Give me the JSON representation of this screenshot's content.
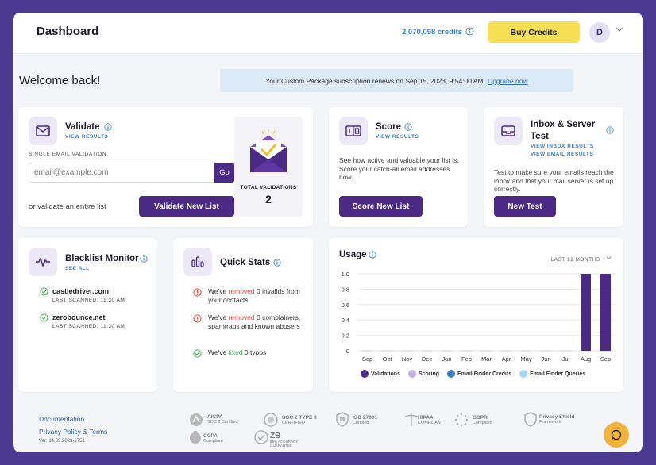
{
  "header": {
    "title": "Dashboard",
    "credits": "2,070,098 credits",
    "buy_label": "Buy Credits",
    "avatar_initial": "D"
  },
  "welcome": "Welcome back!",
  "banner": {
    "text": "Your Custom Package subscription renews on Sep 15, 2023, 9:54:00 AM.",
    "link": "Upgrade now"
  },
  "validate": {
    "title": "Validate",
    "link": "VIEW RESULTS",
    "subtitle": "SINGLE EMAIL VALIDATION",
    "placeholder": "email@example.com",
    "go_label": "Go",
    "or_text": "or validate an entire list",
    "button": "Validate New List",
    "total_label": "TOTAL VALIDATIONS",
    "total_value": "2"
  },
  "score": {
    "title": "Score",
    "link": "VIEW RESULTS",
    "desc": "See how active and valuable your list is. Score your catch-all email addresses now.",
    "button": "Score New List"
  },
  "inbox": {
    "title": "Inbox & Server Test",
    "link1": "VIEW INBOX RESULTS",
    "link2": "VIEW EMAIL RESULTS",
    "desc": "Test to make sure your emails reach the inbox and that your mail server is set up correctly.",
    "button": "New Test"
  },
  "blacklist": {
    "title": "Blacklist Monitor",
    "link": "SEE ALL",
    "items": [
      {
        "domain": "castledriver.com",
        "scan": "LAST SCANNED: 11:30 AM"
      },
      {
        "domain": "zerobounce.net",
        "scan": "LAST SCANNED: 11:30 AM"
      }
    ]
  },
  "quickstats": {
    "title": "Quick Stats",
    "item1_a": "We've ",
    "item1_b": "removed",
    "item1_c": " 0 invalids from your contacts",
    "item2_a": "We've ",
    "item2_b": "removed",
    "item2_c": " 0 complainers, spamtraps and known abusers",
    "item3_a": "We've ",
    "item3_b": "fixed",
    "item3_c": " 0 typos"
  },
  "usage": {
    "title": "Usage",
    "range": "LAST 12 MONTHS"
  },
  "chart_data": {
    "type": "bar",
    "categories": [
      "Sep",
      "Oct",
      "Nov",
      "Dec",
      "Jan",
      "Feb",
      "Mar",
      "Apr",
      "May",
      "Jun",
      "Jul",
      "Aug",
      "Sep"
    ],
    "series": [
      {
        "name": "Validations",
        "color": "#4a2a85",
        "values": [
          0,
          0,
          0,
          0,
          0,
          0,
          0,
          0,
          0,
          0,
          0,
          1,
          1
        ]
      },
      {
        "name": "Scoring",
        "color": "#c5b3e6",
        "values": [
          0,
          0,
          0,
          0,
          0,
          0,
          0,
          0,
          0,
          0,
          0,
          0,
          0
        ]
      },
      {
        "name": "Email Finder Credits",
        "color": "#3e7dc4",
        "values": [
          0,
          0,
          0,
          0,
          0,
          0,
          0,
          0,
          0,
          0,
          0,
          0,
          0
        ]
      },
      {
        "name": "Email Finder Queries",
        "color": "#a9d6f2",
        "values": [
          0,
          0,
          0,
          0,
          0,
          0,
          0,
          0,
          0,
          0,
          0,
          0,
          0
        ]
      }
    ],
    "yticks": [
      "1.0",
      "0.8",
      "0.6",
      "0.4",
      "0.2",
      "0"
    ],
    "ylim": [
      0,
      1.0
    ],
    "grid": true,
    "legend_position": "bottom"
  },
  "footer": {
    "doc": "Documentation",
    "privacy": "Privacy Policy & Terms",
    "version": "Ver: 14.09.2023-1751",
    "badges": [
      {
        "title": "AICPA",
        "sub": "SOC 2 Certified"
      },
      {
        "title": "SOC 2 TYPE II",
        "sub": "CERTIFIED"
      },
      {
        "title": "ISO 27001",
        "sub": "Certified"
      },
      {
        "title": "HIPAA",
        "sub": "COMPLIANT"
      },
      {
        "title": "GDPR",
        "sub": "Compliant"
      },
      {
        "title": "Privacy Shield",
        "sub": "Framework"
      },
      {
        "title": "CCPA",
        "sub": "Compliant"
      },
      {
        "title": "ZB",
        "sub": "99% ACCURACY GUARANTEE"
      }
    ]
  }
}
